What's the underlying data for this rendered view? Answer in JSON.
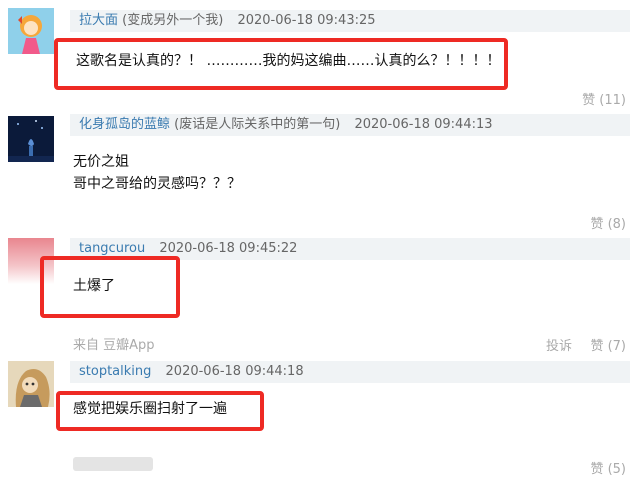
{
  "comments": [
    {
      "user": "拉大面",
      "signature": "(变成另外一个我)",
      "time": "2020-06-18 09:43:25",
      "lines": [
        "这歌名是认真的？！ …………我的妈这编曲……认真的么？！！！！"
      ],
      "likes": "赞 (11)"
    },
    {
      "user": "化身孤岛的蓝鲸",
      "signature": "(废话是人际关系中的第一句)",
      "time": "2020-06-18 09:44:13",
      "lines": [
        "无价之姐",
        "哥中之哥给的灵感吗？？？"
      ],
      "likes": "赞 (8)"
    },
    {
      "user": "tangcurou",
      "signature": "",
      "time": "2020-06-18 09:45:22",
      "lines": [
        "土爆了"
      ],
      "source": "来自 豆瓣App",
      "report": "投诉",
      "likes": "赞 (7)"
    },
    {
      "user": "stoptalking",
      "signature": "",
      "time": "2020-06-18 09:44:18",
      "lines": [
        "感觉把娱乐圈扫射了一遍"
      ],
      "likes": "赞 (5)"
    }
  ],
  "colors": {
    "highlight": "#ee2a24",
    "username": "#3a7bb0",
    "header_bg": "#f0f3f5"
  }
}
